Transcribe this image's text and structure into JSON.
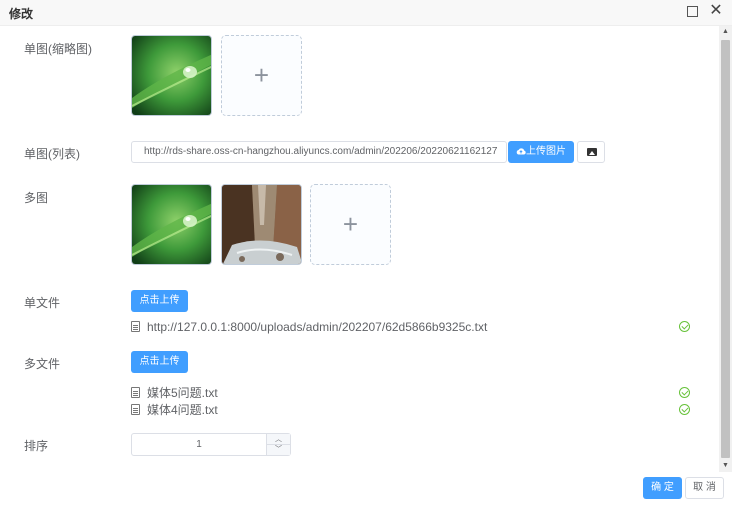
{
  "dialog": {
    "title": "修改",
    "maximize_icon": "maximize-icon",
    "close_icon": "close-icon",
    "close_glyph": "✕"
  },
  "fields": {
    "single_thumb": {
      "label": "单图(缩略图)",
      "image": "water-drop-leaf",
      "add_glyph": "+"
    },
    "single_list": {
      "label": "单图(列表)",
      "value": "http://rds-share.oss-cn-hangzhou.aliyuncs.com/admin/202206/20220621162127",
      "upload_button": "上传图片",
      "upload_icon": "cloud-upload-icon",
      "picture_icon": "picture-icon"
    },
    "multi_image": {
      "label": "多图",
      "images": [
        "water-drop-leaf",
        "canyon-stream"
      ],
      "add_glyph": "+"
    },
    "single_file": {
      "label": "单文件",
      "upload_button": "点击上传",
      "files": [
        "http://127.0.0.1:8000/uploads/admin/202207/62d5866b9325c.txt"
      ]
    },
    "multi_file": {
      "label": "多文件",
      "upload_button": "点击上传",
      "files": [
        "媒体5问题.txt",
        "媒体4问题.txt"
      ]
    },
    "sort": {
      "label": "排序",
      "value": "1"
    }
  },
  "footer": {
    "confirm": "确 定",
    "cancel": "取 消"
  },
  "colors": {
    "primary": "#409eff",
    "success": "#67c23a",
    "border": "#dcdfe6"
  }
}
